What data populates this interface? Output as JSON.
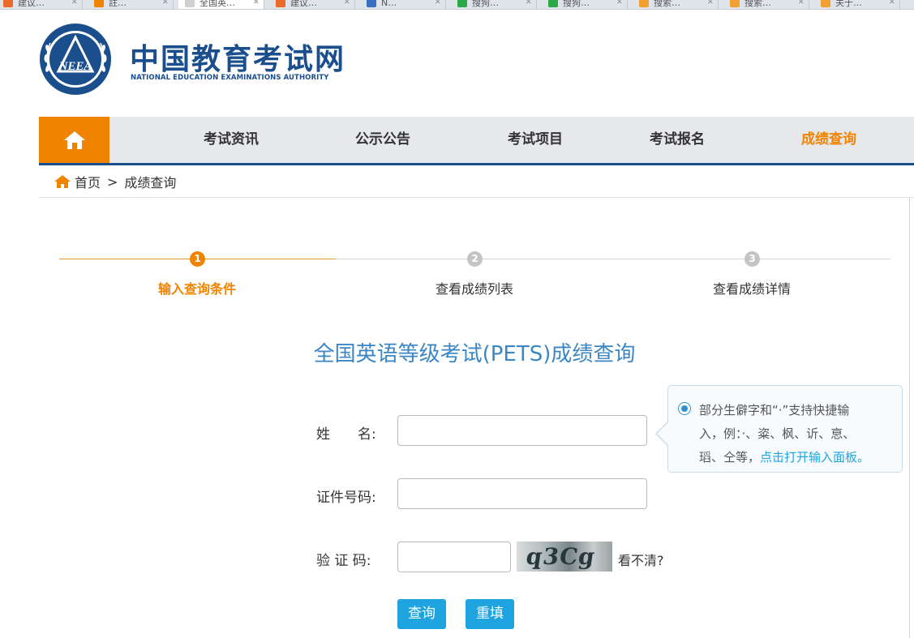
{
  "browser_tabs": [
    {
      "title": "建议…",
      "color": "#e96b2a"
    },
    {
      "title": "註…",
      "color": "#f08300"
    },
    {
      "title": "全国英…",
      "color": "#cfcfcf"
    },
    {
      "title": "建议…",
      "color": "#e96b2a"
    },
    {
      "title": "N…",
      "color": "#3a6fc4"
    },
    {
      "title": "搜狗…",
      "color": "#2aa84a"
    },
    {
      "title": "搜狗…",
      "color": "#2aa84a"
    },
    {
      "title": "搜索…",
      "color": "#f0a030"
    },
    {
      "title": "搜索…",
      "color": "#f0a030"
    },
    {
      "title": "关于…",
      "color": "#f0a030"
    }
  ],
  "header": {
    "logo_cn": "中国教育考试网",
    "logo_en": "NATIONAL EDUCATION EXAMINATIONS AUTHORITY",
    "emblem_text": "NEEA",
    "brand_color": "#1a4e8c"
  },
  "nav": {
    "items": [
      {
        "label": "考试资讯"
      },
      {
        "label": "公示公告"
      },
      {
        "label": "考试项目"
      },
      {
        "label": "考试报名"
      },
      {
        "label": "成绩查询"
      }
    ],
    "active_color": "#f08300"
  },
  "breadcrumb": {
    "home": "首页",
    "separator": ">",
    "current": "成绩查询"
  },
  "steps": [
    {
      "number": "1",
      "label": "输入查询条件",
      "active": true
    },
    {
      "number": "2",
      "label": "查看成绩列表",
      "active": false
    },
    {
      "number": "3",
      "label": "查看成绩详情",
      "active": false
    }
  ],
  "form": {
    "title": "全国英语等级考试(PETS)成绩查询",
    "name_label": "姓　　名:",
    "name_value": "",
    "id_label": "证件号码:",
    "id_value": "",
    "captcha_label": "验 证 码:",
    "captcha_value": "",
    "captcha_text": "q3Cg",
    "unclear_link": "看不清?",
    "submit_label": "查询",
    "reset_label": "重填"
  },
  "tip": {
    "line1": "部分生僻字和“·”支持快捷输",
    "line2": "入，例：·、粢、枫、䜣、恴、",
    "line3_prefix": "瑫、仝等，",
    "line3_link": "点击打开输入面板。"
  }
}
